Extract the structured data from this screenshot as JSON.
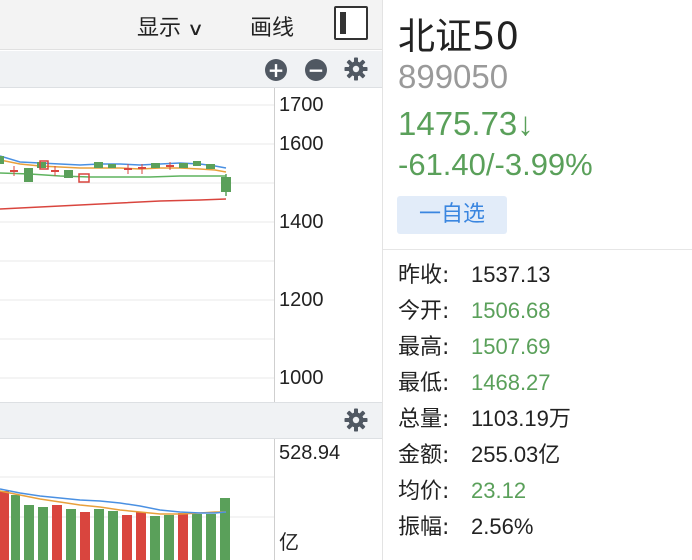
{
  "toolbar": {
    "display_label": "显示",
    "display_chevron": "∨",
    "draw_label": "画线"
  },
  "main_toolbar": {
    "zoom_in_label": "+",
    "zoom_out_label": "−"
  },
  "main_chart": {
    "y_ticks": [
      "1700",
      "1600",
      "1400",
      "1200",
      "1000"
    ]
  },
  "volume_chart": {
    "max_label": "528.94",
    "unit_label": "亿"
  },
  "stock": {
    "name": "北证50",
    "code": "899050",
    "price": "1475.73",
    "price_arrow": "↓",
    "change": "-61.40/-3.99%",
    "watch_label": "一自选"
  },
  "stats": [
    {
      "label": "昨收:",
      "value": "1537.13",
      "color": "normal"
    },
    {
      "label": "今开:",
      "value": "1506.68",
      "color": "green"
    },
    {
      "label": "最高:",
      "value": "1507.69",
      "color": "green"
    },
    {
      "label": "最低:",
      "value": "1468.27",
      "color": "green"
    },
    {
      "label": "总量:",
      "value": "1103.19万",
      "color": "normal"
    },
    {
      "label": "金额:",
      "value": "255.03亿",
      "color": "normal"
    },
    {
      "label": "均价:",
      "value": "23.12",
      "color": "green"
    },
    {
      "label": "振幅:",
      "value": "2.56%",
      "color": "normal"
    }
  ],
  "colors": {
    "up": "#d9453e",
    "down": "#5aa05a",
    "ma_blue": "#4a90e2",
    "ma_orange": "#e8a03c",
    "ma_green": "#5fb35f",
    "ma_red": "#d9453e",
    "watch_text": "#3a86e0"
  },
  "icons": {
    "panel_toggle": "panel-toggle-icon",
    "zoom_in": "plus-circle-icon",
    "zoom_out": "minus-circle-icon",
    "settings": "gear-icon"
  }
}
